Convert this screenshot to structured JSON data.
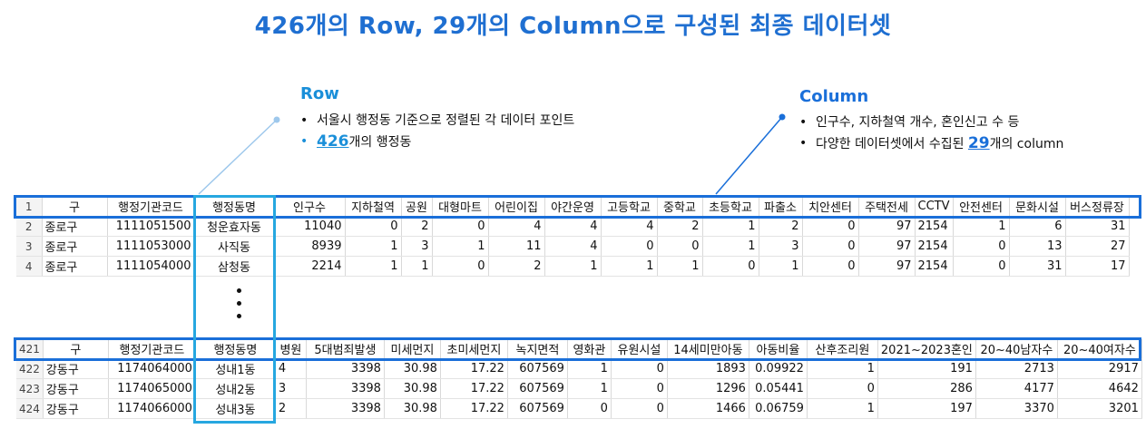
{
  "title": "426개의 Row, 29개의 Column으로 구성된 최종 데이터셋",
  "row_annotation": {
    "heading": "Row",
    "bullet1": "서울시 행정동 기준으로 정렬된 각 데이터 포인트",
    "bullet2_number": "426",
    "bullet2_text": "개의 행정동"
  },
  "column_annotation": {
    "heading": "Column",
    "bullet1": "인구수, 지하철역 개수, 혼인신고 수 등",
    "bullet2_prefix": "다양한 데이터셋에서 수집된 ",
    "bullet2_number": "29",
    "bullet2_suffix": "개의 column"
  },
  "table1": {
    "header": [
      "1",
      "구",
      "행정기관코드",
      "행정동명",
      "인구수",
      "지하철역",
      "공원",
      "대형마트",
      "어린이집",
      "야간운영",
      "고등학교",
      "중학교",
      "초등학교",
      "파출소",
      "치안센터",
      "주택전세",
      "CCTV",
      "안전센터",
      "문화시설",
      "버스정류장"
    ],
    "rows": [
      [
        "2",
        "종로구",
        "1111051500",
        "청운효자동",
        "11040",
        "0",
        "2",
        "0",
        "4",
        "4",
        "4",
        "2",
        "1",
        "2",
        "0",
        "97",
        "2154",
        "1",
        "6",
        "31"
      ],
      [
        "3",
        "종로구",
        "1111053000",
        "사직동",
        "8939",
        "1",
        "3",
        "1",
        "11",
        "4",
        "0",
        "0",
        "1",
        "3",
        "0",
        "97",
        "2154",
        "0",
        "13",
        "27"
      ],
      [
        "4",
        "종로구",
        "1111054000",
        "삼청동",
        "2214",
        "1",
        "1",
        "0",
        "2",
        "1",
        "1",
        "1",
        "0",
        "1",
        "0",
        "97",
        "2154",
        "0",
        "31",
        "17"
      ]
    ]
  },
  "table2": {
    "header": [
      "421",
      "구",
      "행정기관코드",
      "행정동명",
      "병원",
      "5대범죄발생",
      "미세먼지",
      "초미세먼지",
      "녹지면적",
      "영화관",
      "유원시설",
      "14세미만아동",
      "아동비율",
      "산후조리원",
      "2021~2023혼인",
      "20~40남자수",
      "20~40여자수"
    ],
    "rows": [
      [
        "422",
        "강동구",
        "1174064000",
        "성내1동",
        "4",
        "3398",
        "30.98",
        "17.22",
        "607569",
        "1",
        "0",
        "1893",
        "0.09922",
        "1",
        "191",
        "2713",
        "2917"
      ],
      [
        "423",
        "강동구",
        "1174065000",
        "성내2동",
        "3",
        "3398",
        "30.98",
        "17.22",
        "607569",
        "1",
        "0",
        "1296",
        "0.05441",
        "0",
        "286",
        "4177",
        "4642"
      ],
      [
        "424",
        "강동구",
        "1174066000",
        "성내3동",
        "2",
        "3398",
        "30.98",
        "17.22",
        "607569",
        "0",
        "0",
        "1466",
        "0.06759",
        "1",
        "197",
        "3370",
        "3201"
      ]
    ]
  },
  "colors": {
    "title": "#1f6fd1",
    "row_highlight": "#1a6fd9",
    "column_highlight": "#26a7e0",
    "accent_number": "#1a8fd9"
  }
}
